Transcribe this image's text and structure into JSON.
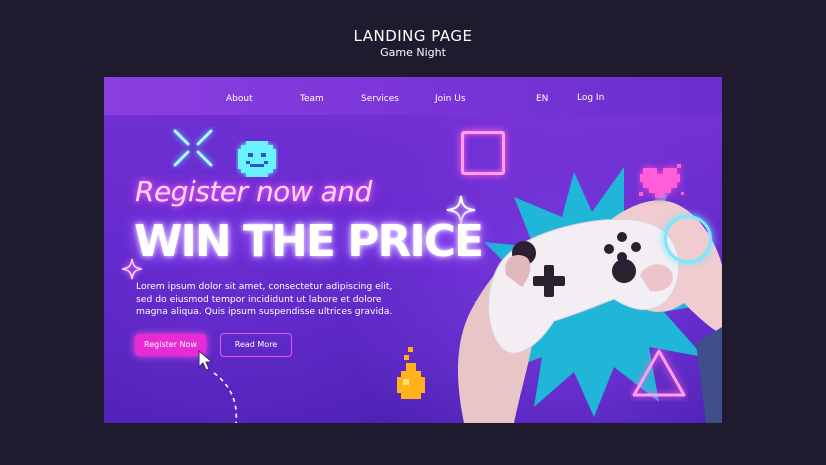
{
  "header": {
    "title": "LANDING PAGE",
    "subtitle": "Game Night"
  },
  "nav": {
    "items": [
      "About",
      "Team",
      "Services",
      "Join Us"
    ],
    "language": "EN",
    "login": "Log In"
  },
  "hero": {
    "headline_line1": "Register now and",
    "headline_line2": "WIN THE PRICE",
    "body_lines": [
      "Lorem ipsum dolor sit amet, consectetur adipiscing elit,",
      "sed do eiusmod tempor incididunt ut labore et dolore",
      "magna aliqua. Quis ipsum suspendisse ultrices gravida."
    ],
    "primary_button": "Register Now",
    "secondary_button": "Read More"
  },
  "colors": {
    "page_bg": "#201a2e",
    "accent_pink": "#e92bd6",
    "neon_cyan": "#5ee8ff",
    "neon_pink": "#ff6ad5",
    "teal_burst": "#1fb6d8"
  },
  "icons": [
    "x-icon",
    "smiley-icon",
    "square-outline-icon",
    "sparkle-icon",
    "heart-icon",
    "circle-outline-icon",
    "triangle-outline-icon",
    "potion-icon",
    "cursor-icon",
    "game-controller-image"
  ]
}
